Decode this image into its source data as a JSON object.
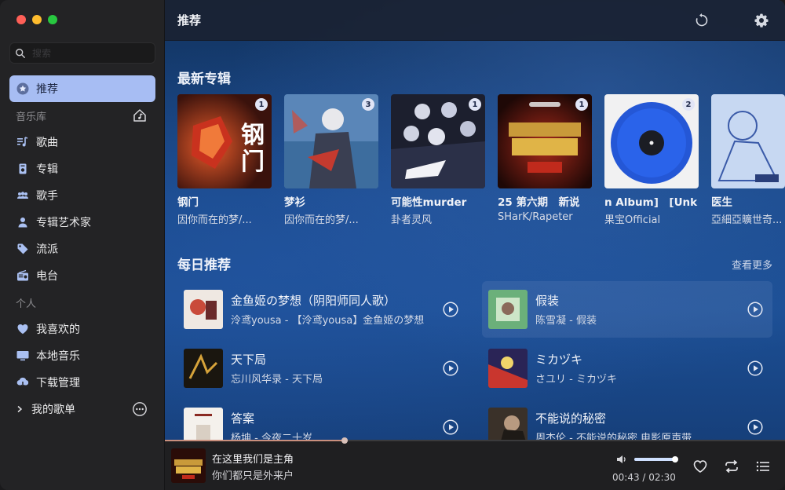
{
  "sidebar": {
    "search_placeholder": "搜索",
    "active_item": {
      "label": "推荐",
      "icon": "star-icon"
    },
    "library_title": "音乐库",
    "library_items": [
      {
        "label": "歌曲",
        "icon": "music-note-icon"
      },
      {
        "label": "专辑",
        "icon": "album-icon"
      },
      {
        "label": "歌手",
        "icon": "people-icon"
      },
      {
        "label": "专辑艺术家",
        "icon": "person-icon"
      },
      {
        "label": "流派",
        "icon": "tag-icon"
      },
      {
        "label": "电台",
        "icon": "radio-icon"
      }
    ],
    "personal_title": "个人",
    "personal_items": [
      {
        "label": "我喜欢的",
        "icon": "heart-icon"
      },
      {
        "label": "本地音乐",
        "icon": "monitor-icon"
      },
      {
        "label": "下载管理",
        "icon": "cloud-download-icon"
      }
    ],
    "playlist_label": "我的歌单"
  },
  "header": {
    "title": "推荐"
  },
  "sections": {
    "new_albums": "最新专辑",
    "daily": "每日推荐",
    "see_more": "查看更多"
  },
  "albums": [
    {
      "name": "钢门",
      "artist": "因你而在的梦/...",
      "count": "1"
    },
    {
      "name": "梦衫",
      "artist": "因你而在的梦/...",
      "count": "3"
    },
    {
      "name": "可能性murder",
      "artist": "卦者灵风",
      "count": "1"
    },
    {
      "name": "25 第六期　新说",
      "artist": "SHarK/Rapeter",
      "count": "1"
    },
    {
      "name": "n Album]　[Unk",
      "artist": "果宝Official",
      "count": "2"
    },
    {
      "name": "医生",
      "artist": "亞細亞曠世奇..."
    }
  ],
  "daily_songs": [
    {
      "title": "金鱼姬の梦想（阴阳师同人歌）",
      "subtitle": "泠鸢yousa - 【泠鸢yousa】金鱼姬の梦想"
    },
    {
      "title": "假装",
      "subtitle": "陈雪凝 - 假装"
    },
    {
      "title": "天下局",
      "subtitle": "忘川风华录 - 天下局"
    },
    {
      "title": "ミカヅキ",
      "subtitle": "さユリ - ミカヅキ"
    },
    {
      "title": "答案",
      "subtitle": "杨坤 - 今夜二十岁"
    },
    {
      "title": "不能说的秘密",
      "subtitle": "周杰伦 - 不能说的秘密 电影原声带"
    }
  ],
  "player": {
    "title": "在这里我们是主角",
    "subtitle": "你们都只是外来户",
    "time": "00:43 / 02:30",
    "progress": 0.29,
    "volume": 0.93
  },
  "colors": {
    "accent": "#a7bdf3",
    "sidebar": "#232325",
    "progress": "#c98f7d"
  }
}
